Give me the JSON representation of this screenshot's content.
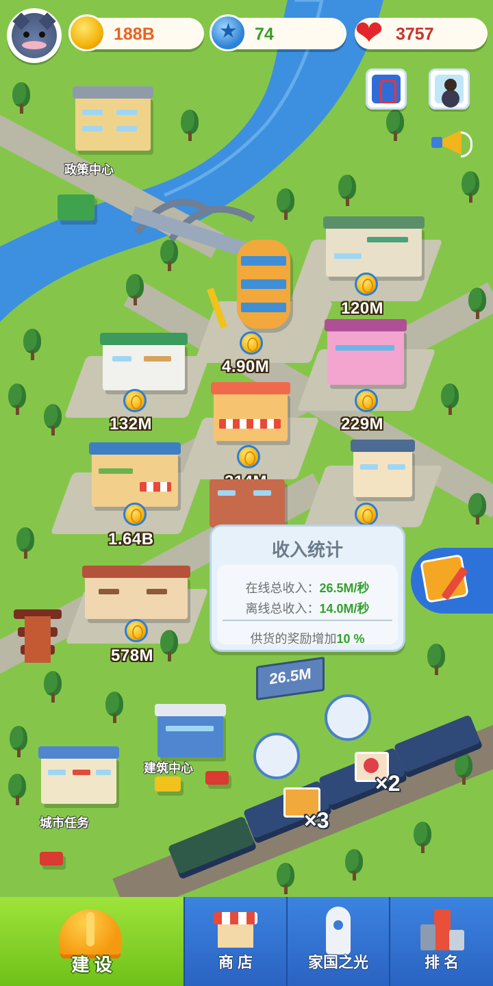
{
  "hud": {
    "coins": "188B",
    "stars": "74",
    "hearts": "3757"
  },
  "map": {
    "labels": {
      "policy_center": "政策中心",
      "building_center": "建筑中心",
      "city_tasks": "城市任务"
    },
    "income": {
      "b1": "120M",
      "b2": "4.90M",
      "b3": "132M",
      "b4": "229M",
      "b5": "314M",
      "b6": "1.64B",
      "b7": "578M"
    },
    "billboard": "26.5M",
    "train": {
      "cargo_box_multiplier": "×3",
      "cargo_gift_multiplier": "×2"
    }
  },
  "stats_panel": {
    "title": "收入统计",
    "online_label": "在线总收入：",
    "online_value": "26.5M/秒",
    "offline_label": "离线总收入：",
    "offline_value": "14.0M/秒",
    "bonus_label": "供货的奖励增加",
    "bonus_value": "10 %"
  },
  "nav": {
    "build": "建 设",
    "shop": "商 店",
    "home": "家国之光",
    "rank": "排 名"
  },
  "colors": {
    "grass": "#85c64a",
    "river": "#3d8fe0",
    "income_green": "#33a02c",
    "nav_blue": "#2f6fcf",
    "nav_active_green": "#7fd12a"
  }
}
